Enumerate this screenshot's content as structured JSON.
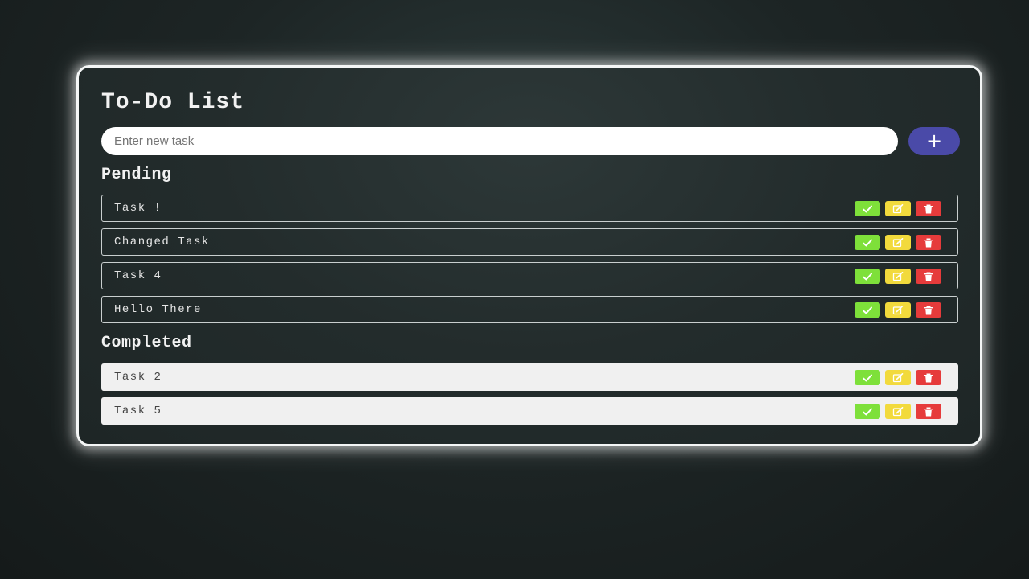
{
  "app": {
    "title": "To-Do List"
  },
  "input": {
    "placeholder": "Enter new task",
    "value": "",
    "add_label": "+"
  },
  "sections": {
    "pending_title": "Pending",
    "completed_title": "Completed"
  },
  "pending": [
    {
      "label": "Task !"
    },
    {
      "label": "Changed Task"
    },
    {
      "label": "Task 4"
    },
    {
      "label": "Hello There"
    }
  ],
  "completed": [
    {
      "label": "Task 2"
    },
    {
      "label": "Task 5"
    }
  ],
  "icons": {
    "complete": "check-icon",
    "edit": "edit-icon",
    "delete": "trash-icon"
  },
  "colors": {
    "add_button": "#4a4aa8",
    "complete_button": "#7ee03a",
    "edit_button": "#f2da3c",
    "delete_button": "#e63b3b"
  }
}
